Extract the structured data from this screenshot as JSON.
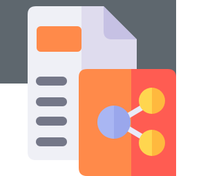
{
  "icon": {
    "name": "share-document-icon",
    "depicts": [
      "document-icon",
      "share-icon"
    ],
    "text_line_count": 4
  },
  "colors": {
    "top_band": "#5e676e",
    "page_light": "#eff0f6",
    "page_shade": "#dfdcee",
    "page_fold": "#c6c1e4",
    "header_block": "#ff8a4a",
    "text_lines": "#747788",
    "card_left": "#ff8a4a",
    "card_right": "#ff5c52",
    "node_left_a": "#a9b6f3",
    "node_left_b": "#9aa7ec",
    "nodes_right_a": "#ffd64f",
    "nodes_right_b": "#ffb93e",
    "connectors": "#e9eaf8"
  }
}
